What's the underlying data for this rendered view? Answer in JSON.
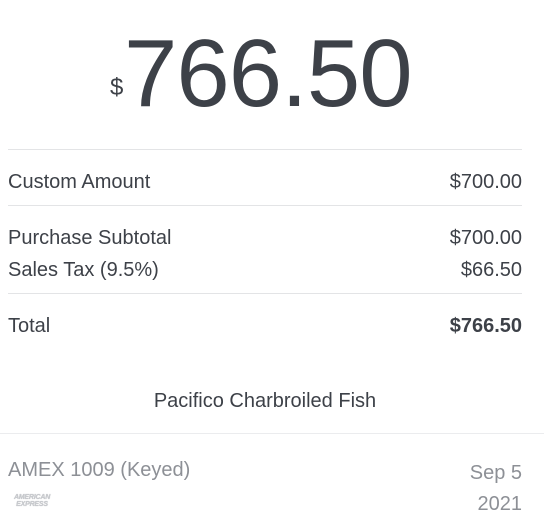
{
  "amount": {
    "currency_symbol": "$",
    "value": "766.50"
  },
  "line_items": [
    {
      "label": "Custom Amount",
      "value": "$700.00"
    }
  ],
  "summary": [
    {
      "label": "Purchase Subtotal",
      "value": "$700.00"
    },
    {
      "label": "Sales Tax (9.5%)",
      "value": "$66.50"
    }
  ],
  "total": {
    "label": "Total",
    "value": "$766.50"
  },
  "merchant": {
    "name": "Pacifico Charbroiled Fish"
  },
  "payment": {
    "card": "AMEX 1009 (Keyed)",
    "date": "Sep 5 2021",
    "card_brand_logo": {
      "icon": "american-express-logo-icon",
      "line1": "AMERICAN",
      "line2": "EXPRESS"
    }
  },
  "colors": {
    "text_primary": "#3d4148",
    "text_secondary": "#8d9096",
    "divider": "#e3e4e6",
    "background": "#ffffff"
  }
}
